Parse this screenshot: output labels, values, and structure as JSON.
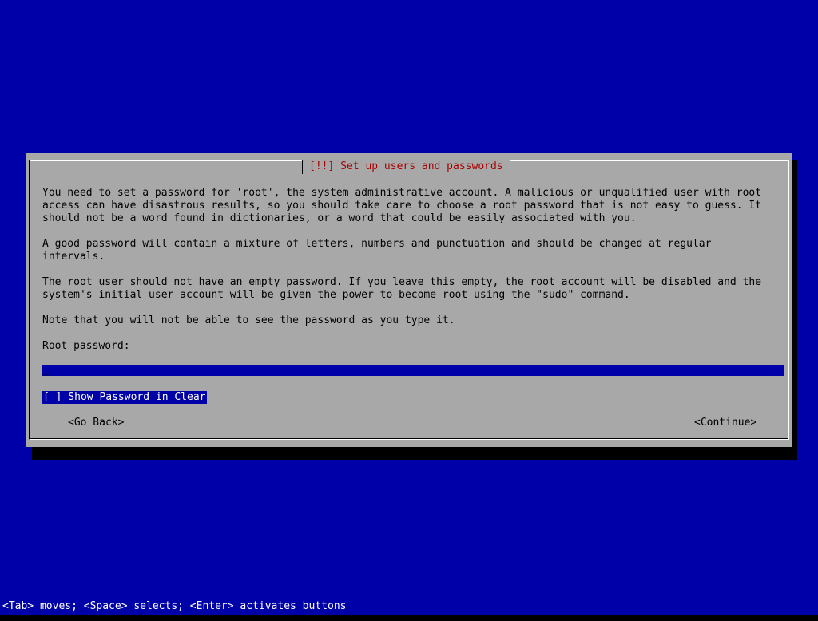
{
  "dialog": {
    "title": "[!!] Set up users and passwords",
    "paragraphs": [
      "You need to set a password for 'root', the system administrative account. A malicious or unqualified user with root\naccess can have disastrous results, so you should take care to choose a root password that is not easy to guess. It\nshould not be a word found in dictionaries, or a word that could be easily associated with you.",
      "A good password will contain a mixture of letters, numbers and punctuation and should be changed at regular\nintervals.",
      "The root user should not have an empty password. If you leave this empty, the root account will be disabled and the\nsystem's initial user account will be given the power to become root using the \"sudo\" command.",
      "Note that you will not be able to see the password as you type it."
    ],
    "field_label": "Root password:",
    "password_value": "",
    "cursor": "_",
    "checkbox_label": "[ ] Show Password in Clear",
    "back_button": "<Go Back>",
    "continue_button": "<Continue>"
  },
  "statusbar": {
    "text": "<Tab> moves; <Space> selects; <Enter> activates buttons"
  },
  "colors": {
    "background": "#0000a8",
    "dialog": "#a8a8a8",
    "title": "#a80000",
    "selection": "#0000a8"
  }
}
